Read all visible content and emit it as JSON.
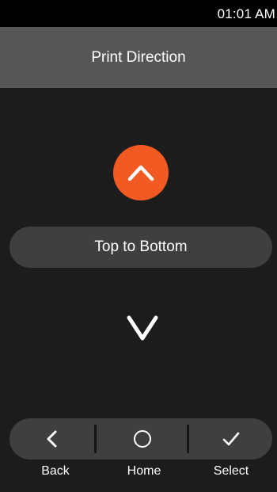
{
  "status_bar": {
    "time": "01:01 AM"
  },
  "header": {
    "title": "Print Direction"
  },
  "selector": {
    "up_icon": "chevron-up-icon",
    "current_option": "Top to Bottom",
    "down_icon": "chevron-down-icon"
  },
  "nav": {
    "back_label": "Back",
    "home_label": "Home",
    "select_label": "Select",
    "back_icon": "chevron-left-icon",
    "home_icon": "circle-icon",
    "select_icon": "check-icon"
  },
  "colors": {
    "accent": "#f15a22",
    "title_bar": "#565656",
    "background": "#1c1c1c",
    "pill": "#3f3f3f"
  }
}
